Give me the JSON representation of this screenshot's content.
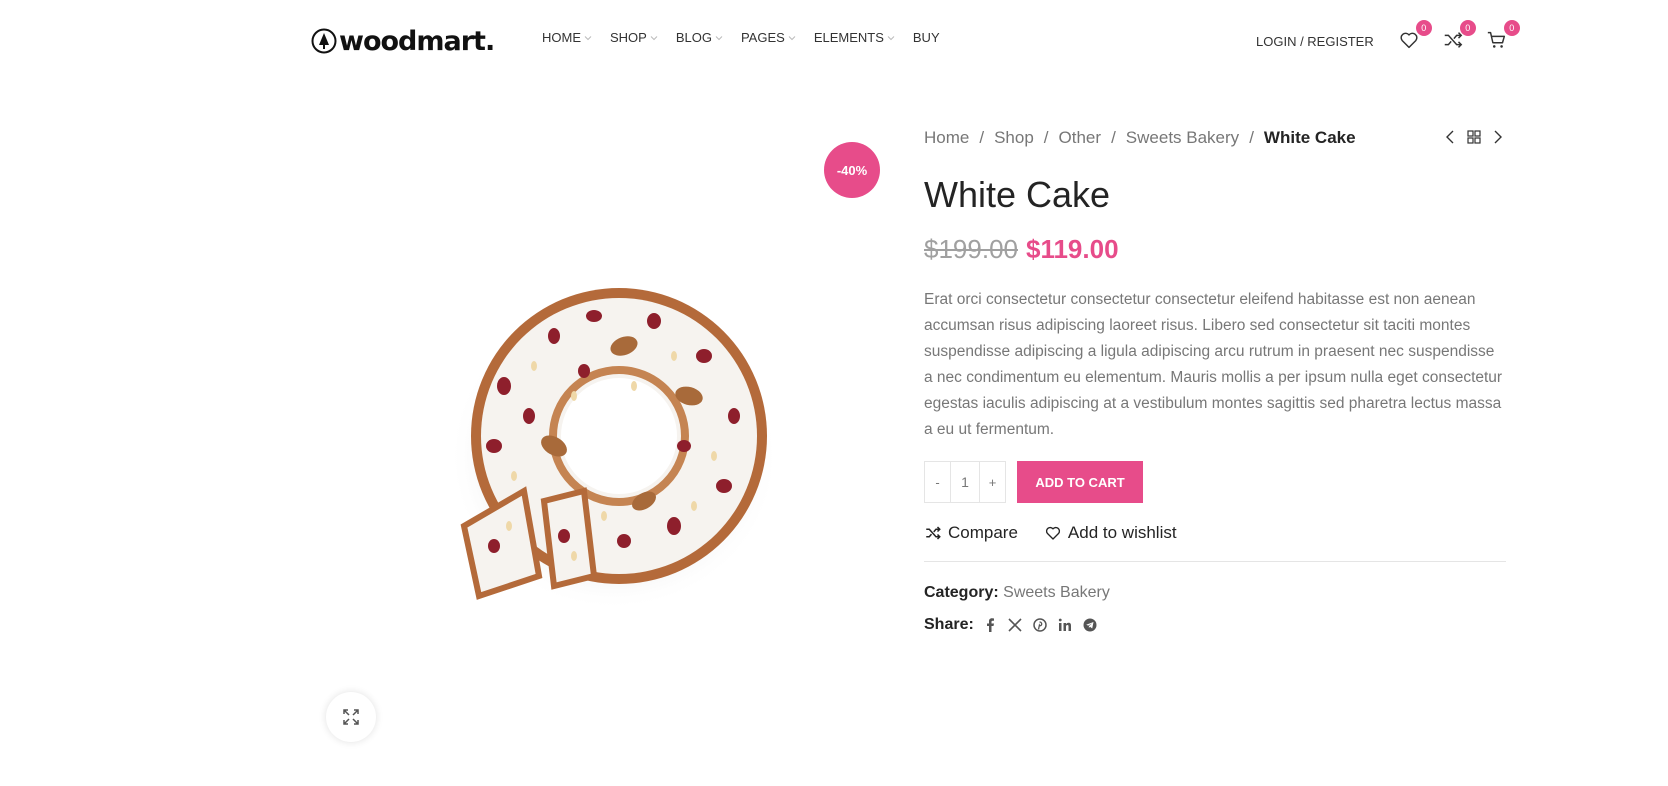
{
  "brand": {
    "name": "woodmart.",
    "accent": "#e74c8a"
  },
  "nav": {
    "items": [
      {
        "label": "HOME",
        "has_dropdown": true
      },
      {
        "label": "SHOP",
        "has_dropdown": true
      },
      {
        "label": "BLOG",
        "has_dropdown": true
      },
      {
        "label": "PAGES",
        "has_dropdown": true
      },
      {
        "label": "ELEMENTS",
        "has_dropdown": true
      },
      {
        "label": "BUY",
        "has_dropdown": false
      }
    ]
  },
  "header": {
    "login_label": "LOGIN / REGISTER",
    "wishlist_count": "0",
    "compare_count": "0",
    "cart_count": "0"
  },
  "gallery": {
    "sale_badge": "-40%",
    "image_icon": "cake-image"
  },
  "breadcrumb": {
    "items": [
      "Home",
      "Shop",
      "Other",
      "Sweets Bakery"
    ],
    "current": "White Cake",
    "separator": "/"
  },
  "product": {
    "title": "White Cake",
    "old_price": "$199.00",
    "new_price": "$119.00",
    "description": "Erat orci consectetur consectetur consectetur eleifend habitasse est non aenean accumsan risus adipiscing laoreet risus. Libero sed consectetur sit taciti montes suspendisse adipiscing a ligula adipiscing arcu rutrum in praesent nec suspendisse a nec condimentum eu elementum. Mauris mollis a per ipsum nulla eget consectetur egestas iaculis adipiscing at a vestibulum montes sagittis sed pharetra lectus massa a eu ut fermentum.",
    "qty_minus": "-",
    "qty_value": "1",
    "qty_plus": "+",
    "add_to_cart": "ADD TO CART",
    "compare_label": "Compare",
    "wishlist_label": "Add to wishlist",
    "category_label": "Category:",
    "category_value": "Sweets Bakery",
    "share_label": "Share:"
  }
}
